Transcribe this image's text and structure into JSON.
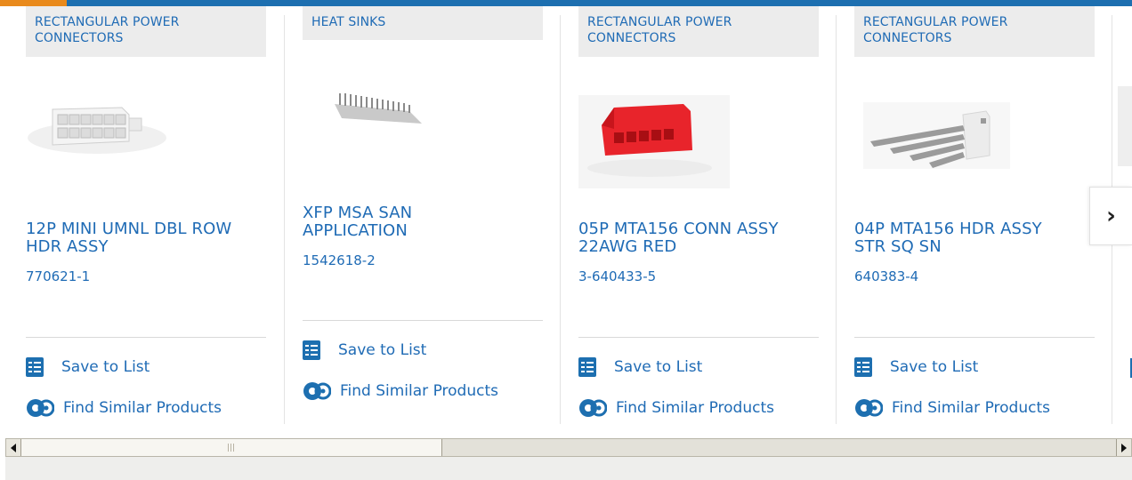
{
  "navigation": {
    "next_arrow": "›"
  },
  "actions": {
    "save_label": "Save to List",
    "similar_label": "Find Similar Products"
  },
  "products": [
    {
      "category": "RECTANGULAR POWER CONNECTORS",
      "title_line1": "12P MINI UMNL DBL ROW",
      "title_line2": "HDR ASSY",
      "part_number": "770621-1"
    },
    {
      "category": "HEAT SINKS",
      "title_line1": "XFP MSA SAN",
      "title_line2": "APPLICATION",
      "part_number": "1542618-2"
    },
    {
      "category": "RECTANGULAR POWER CONNECTORS",
      "title_line1": "05P MTA156 CONN ASSY",
      "title_line2": "22AWG RED",
      "part_number": "3-640433-5"
    },
    {
      "category": "RECTANGULAR POWER CONNECTORS",
      "title_line1": "04P MTA156 HDR ASSY",
      "title_line2": "STR SQ SN",
      "part_number": "640383-4"
    }
  ],
  "colors": {
    "brand_blue": "#1f6bb5",
    "accent_orange": "#e98a1c",
    "connector_red": "#e8242b"
  }
}
